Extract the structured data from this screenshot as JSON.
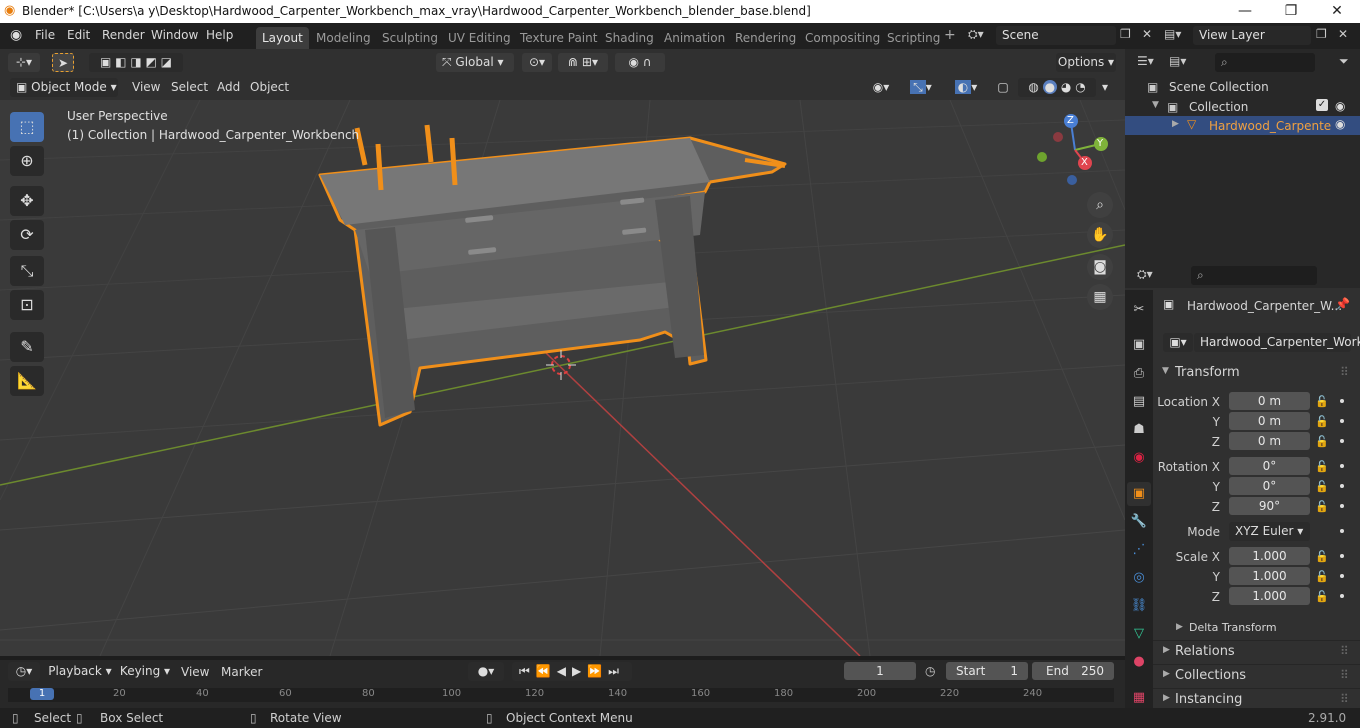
{
  "window": {
    "title": "Blender* [C:\\Users\\a y\\Desktop\\Hardwood_Carpenter_Workbench_max_vray\\Hardwood_Carpenter_Workbench_blender_base.blend]"
  },
  "menubar": {
    "items": [
      "File",
      "Edit",
      "Render",
      "Window",
      "Help"
    ]
  },
  "workspaces": [
    "Layout",
    "Modeling",
    "Sculpting",
    "UV Editing",
    "Texture Paint",
    "Shading",
    "Animation",
    "Rendering",
    "Compositing",
    "Scripting"
  ],
  "scene": {
    "name": "Scene",
    "view_layer": "View Layer"
  },
  "header": {
    "transform_orientation": "Global",
    "options": "Options"
  },
  "viewport_header": {
    "mode": "Object Mode",
    "menus": [
      "View",
      "Select",
      "Add",
      "Object"
    ]
  },
  "viewport": {
    "info_line1": "User Perspective",
    "info_line2": "(1) Collection | Hardwood_Carpenter_Workbench",
    "gizmo": {
      "x": "X",
      "y": "Y",
      "z": "Z"
    }
  },
  "outliner": {
    "scene_collection": "Scene Collection",
    "collection": "Collection",
    "object": "Hardwood_Carpente"
  },
  "properties": {
    "object_name": "Hardwood_Carpenter_W...",
    "data_name": "Hardwood_Carpenter_Work...",
    "transform_title": "Transform",
    "location": {
      "label": "Location X",
      "x": "0 m",
      "y": "0 m",
      "z": "0 m"
    },
    "rotation": {
      "label": "Rotation X",
      "x": "0°",
      "y": "0°",
      "z": "90°"
    },
    "mode": {
      "label": "Mode",
      "value": "XYZ Euler"
    },
    "scale": {
      "label": "Scale X",
      "x": "1.000",
      "y": "1.000",
      "z": "1.000"
    },
    "axis_y": "Y",
    "axis_z": "Z",
    "panels": [
      "Delta Transform",
      "Relations",
      "Collections",
      "Instancing"
    ]
  },
  "timeline": {
    "menus": [
      "Playback",
      "Keying",
      "View",
      "Marker"
    ],
    "current_frame": "1",
    "start_label": "Start",
    "start": "1",
    "end_label": "End",
    "end": "250",
    "ticks": [
      "20",
      "40",
      "60",
      "80",
      "100",
      "120",
      "140",
      "160",
      "180",
      "200",
      "220",
      "240"
    ]
  },
  "statusbar": {
    "select": "Select",
    "box_select": "Box Select",
    "rotate_view": "Rotate View",
    "context_menu": "Object Context Menu",
    "version": "2.91.0"
  }
}
